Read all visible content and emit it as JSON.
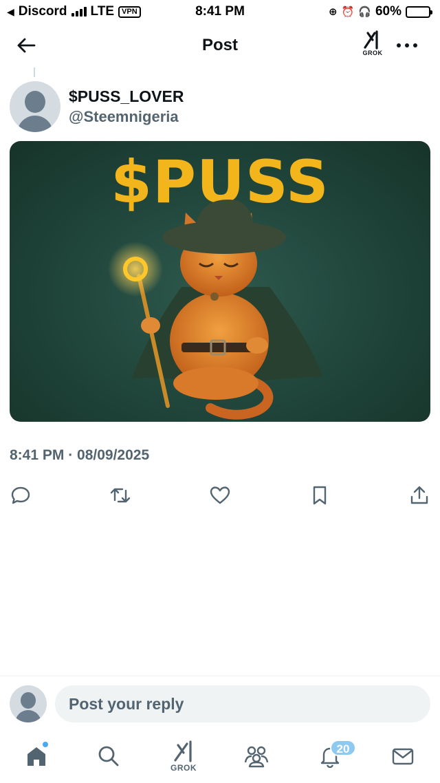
{
  "status_bar": {
    "back_app": "Discord",
    "network": "LTE",
    "vpn": "VPN",
    "time": "8:41 PM",
    "battery": "60%",
    "battery_level": 0.6
  },
  "header": {
    "title": "Post",
    "grok_label": "GROK"
  },
  "post": {
    "display_name": "$PUSS_LOVER",
    "handle": "@Steemnigeria",
    "image_title": "$PUSS",
    "timestamp": "8:41 PM · 08/09/2025"
  },
  "reply": {
    "placeholder": "Post your reply"
  },
  "bottom_nav": {
    "grok_label": "GROK",
    "notifications_badge": "20"
  },
  "icons": [
    "back-arrow-icon",
    "grok-icon",
    "more-icon",
    "reply-icon",
    "repost-icon",
    "like-icon",
    "bookmark-icon",
    "share-icon",
    "home-icon",
    "search-icon",
    "communities-icon",
    "notifications-icon",
    "messages-icon"
  ]
}
